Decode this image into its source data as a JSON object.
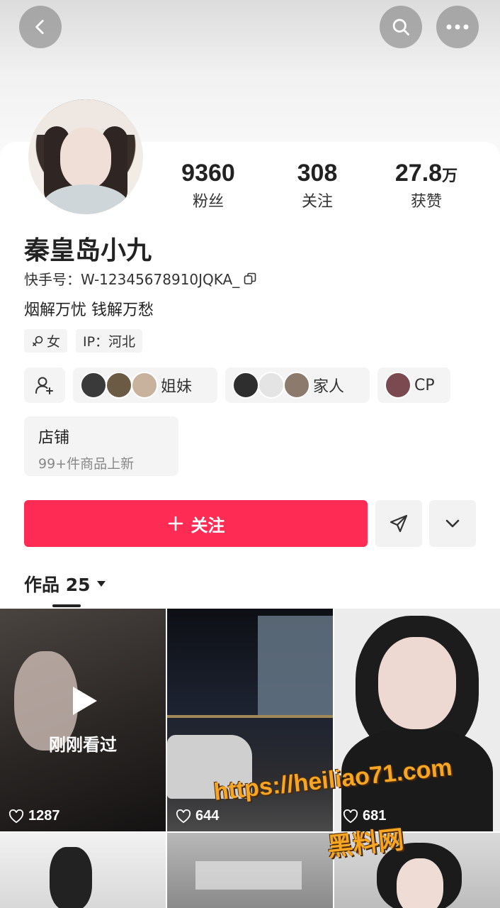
{
  "profile": {
    "name": "秦皇岛小九",
    "kuaishou_id": "快手号：W-12345678910JQKA_",
    "bio": "烟解万忧 钱解万愁",
    "gender_tag": "女",
    "ip_tag": "IP：河北"
  },
  "stats": {
    "fans_value": "9360",
    "fans_label": "粉丝",
    "following_value": "308",
    "following_label": "关注",
    "likes_value": "27.8",
    "likes_unit": "万",
    "likes_label": "获赞"
  },
  "relations": {
    "sisters": "姐妹",
    "family": "家人",
    "cp": "CP"
  },
  "shop": {
    "title": "店铺",
    "subtitle": "99+件商品上新"
  },
  "actions": {
    "follow_label": "关注"
  },
  "works": {
    "label": "作品 25"
  },
  "grid": {
    "recently_watched": "刚刚看过",
    "likes": [
      "1287",
      "644",
      "681"
    ]
  },
  "watermark": {
    "url": "https://heiliao71.com",
    "site": "黑料网"
  },
  "icons": {
    "back": "chevron-left-icon",
    "search": "search-icon",
    "more": "more-icon",
    "copy": "copy-icon",
    "add_friend": "add-person-icon",
    "share": "send-icon",
    "expand": "chevron-down-icon",
    "heart": "heart-icon",
    "play": "play-icon"
  },
  "colors": {
    "accent": "#fe2c55",
    "watermark": "#f6a623"
  }
}
